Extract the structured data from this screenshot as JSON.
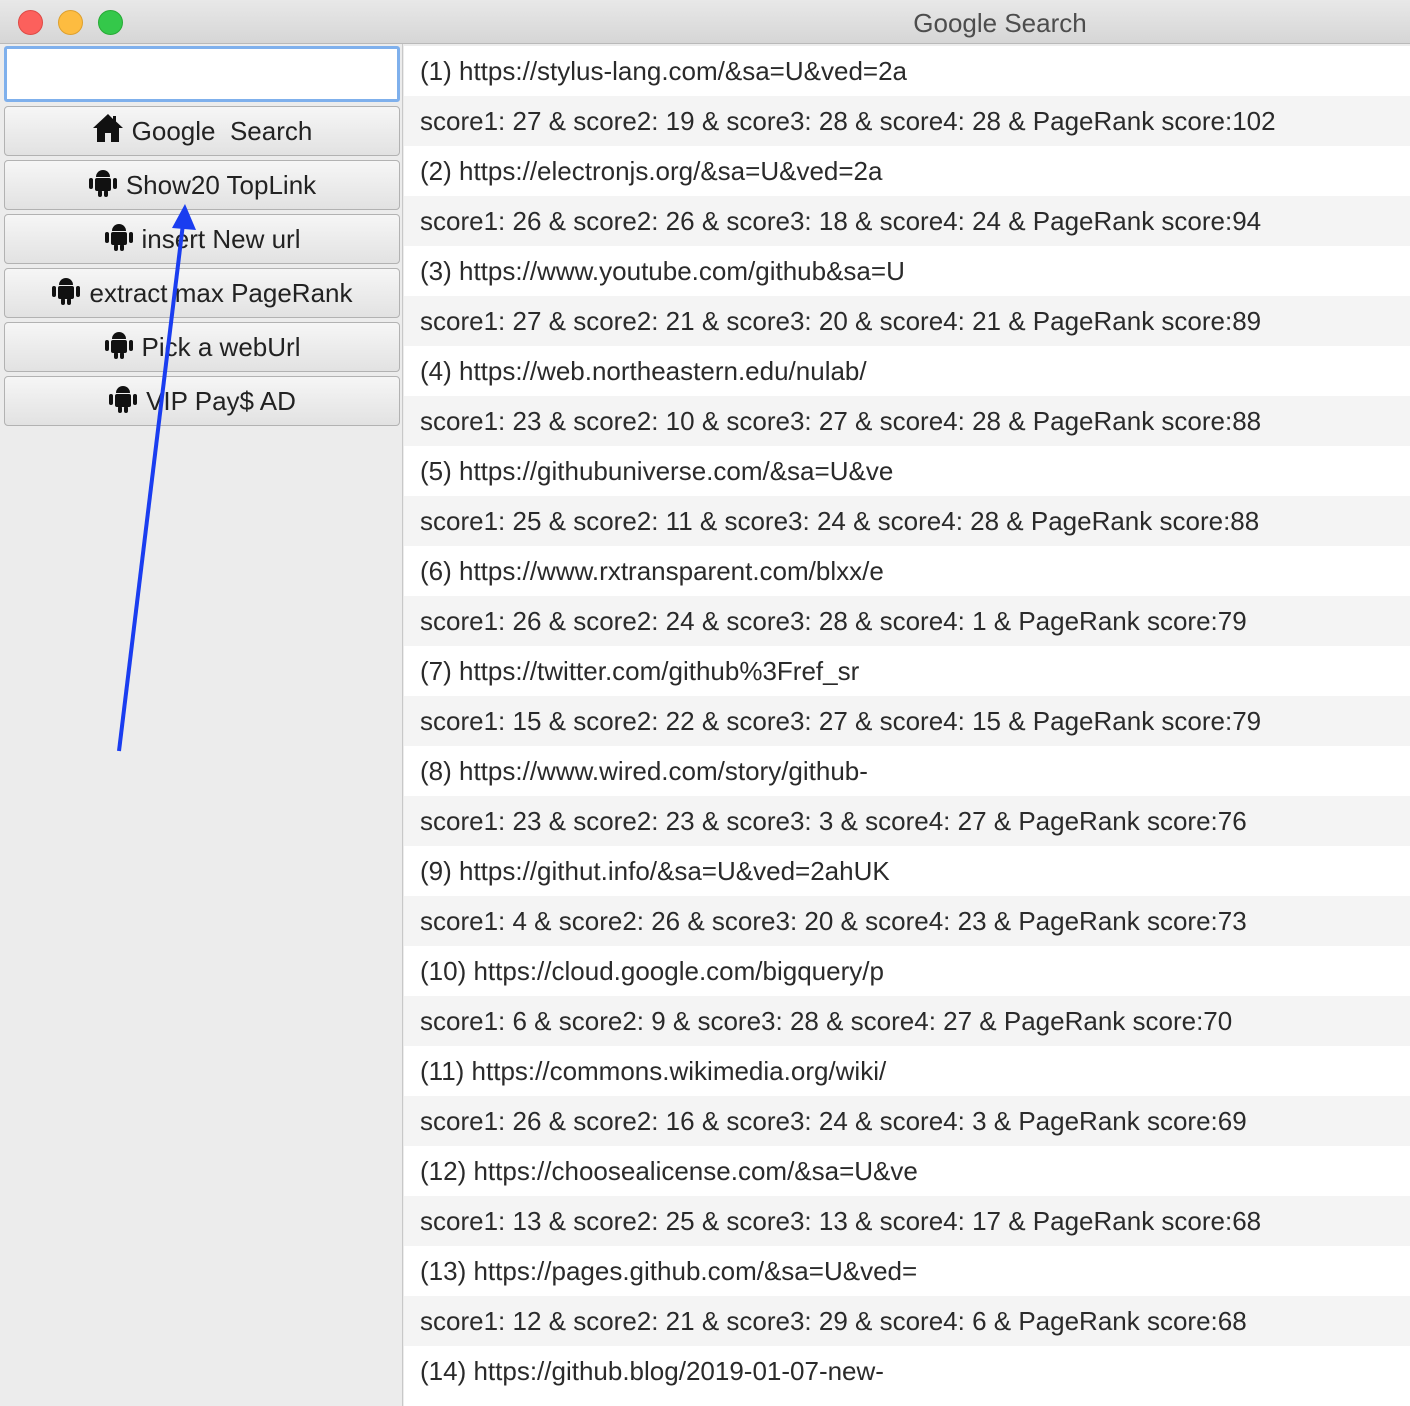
{
  "window": {
    "title": "Google Search"
  },
  "search": {
    "value": "",
    "placeholder": ""
  },
  "buttons": [
    {
      "label": "Google  Search",
      "icon": "home-icon"
    },
    {
      "label": "Show20 TopLink",
      "icon": "android-icon"
    },
    {
      "label": "insert New url",
      "icon": "android-icon"
    },
    {
      "label": "extract max PageRank",
      "icon": "android-icon"
    },
    {
      "label": "Pick a webUrl",
      "icon": "android-icon"
    },
    {
      "label": "VIP Pay$ AD",
      "icon": "android-icon"
    }
  ],
  "annotation": {
    "color": "#1a3df0"
  },
  "results": [
    "(1) https://stylus-lang.com/&sa=U&ved=2a",
    "score1: 27 & score2: 19 & score3: 28 & score4: 28 & PageRank score:102",
    "(2) https://electronjs.org/&sa=U&ved=2a",
    "score1: 26 & score2: 26 & score3: 18 & score4: 24 & PageRank score:94",
    "(3) https://www.youtube.com/github&sa=U",
    "score1: 27 & score2: 21 & score3: 20 & score4: 21 & PageRank score:89",
    "(4) https://web.northeastern.edu/nulab/",
    "score1: 23 & score2: 10 & score3: 27 & score4: 28 & PageRank score:88",
    "(5) https://githubuniverse.com/&sa=U&ve",
    "score1: 25 & score2: 11 & score3: 24 & score4: 28 & PageRank score:88",
    "(6) https://www.rxtransparent.com/blxx/e",
    "score1: 26 & score2: 24 & score3: 28 & score4: 1 & PageRank score:79",
    "(7) https://twitter.com/github%3Fref_sr",
    "score1: 15 & score2: 22 & score3: 27 & score4: 15 & PageRank score:79",
    "(8) https://www.wired.com/story/github-",
    "score1: 23 & score2: 23 & score3: 3 & score4: 27 & PageRank score:76",
    "(9) https://githut.info/&sa=U&ved=2ahUK",
    "score1: 4 & score2: 26 & score3: 20 & score4: 23 & PageRank score:73",
    "(10) https://cloud.google.com/bigquery/p",
    "score1: 6 & score2: 9 & score3: 28 & score4: 27 & PageRank score:70",
    "(11) https://commons.wikimedia.org/wiki/",
    "score1: 26 & score2: 16 & score3: 24 & score4: 3 & PageRank score:69",
    "(12) https://choosealicense.com/&sa=U&ve",
    "score1: 13 & score2: 25 & score3: 13 & score4: 17 & PageRank score:68",
    "(13) https://pages.github.com/&sa=U&ved=",
    "score1: 12 & score2: 21 & score3: 29 & score4: 6 & PageRank score:68",
    "(14) https://github.blog/2019-01-07-new-"
  ]
}
